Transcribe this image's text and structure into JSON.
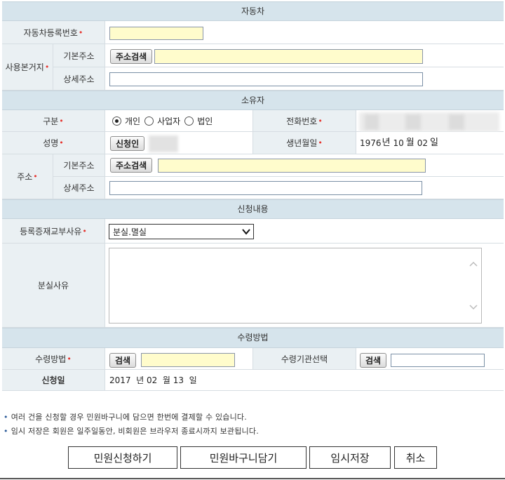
{
  "sections": {
    "vehicle": "자동차",
    "owner": "소유자",
    "request": "신청내용",
    "receipt": "수령방법"
  },
  "vehicle": {
    "reg_no_label": "자동차등록번호",
    "location_label": "사용본거지",
    "base_addr_label": "기본주소",
    "detail_addr_label": "상세주소",
    "addr_search_btn": "주소검색"
  },
  "owner": {
    "category_label": "구분",
    "category_options": [
      "개인",
      "사업자",
      "법인"
    ],
    "category_selected": "개인",
    "phone_label": "전화번호",
    "name_label": "성명",
    "applicant_btn": "신청인",
    "birth_label": "생년월일",
    "birth_year": "1976",
    "birth_year_unit": "년",
    "birth_month": "10",
    "birth_month_unit": "월",
    "birth_day": "02",
    "birth_day_unit": "일",
    "addr_label": "주소",
    "base_addr_label": "기본주소",
    "detail_addr_label": "상세주소",
    "addr_search_btn": "주소검색"
  },
  "request": {
    "reason_label": "등록증재교부사유",
    "reason_value": "분실.멸실",
    "loss_reason_label": "분실사유"
  },
  "receipt": {
    "method_label": "수령방법",
    "search_btn": "검색",
    "agency_label": "수령기관선택",
    "agency_search_btn": "검색",
    "date_label": "신청일",
    "date_text": "2017  년 02  월 13  일"
  },
  "notes": [
    "여러 건을 신청할 경우 민원바구니에 담으면 한번에 결제할 수 있습니다.",
    "임시 저장은 회원은 일주일동안, 비회원은 브라우저 종료시까지 보관됩니다."
  ],
  "actions": {
    "submit": "민원신청하기",
    "basket": "민원바구니담기",
    "temp_save": "임시저장",
    "cancel": "취소"
  },
  "colors": {
    "header_bg": "#d6e4ec",
    "label_bg": "#eaf0f3",
    "required": "#e6352f",
    "input_yellow": "#fffccc"
  }
}
